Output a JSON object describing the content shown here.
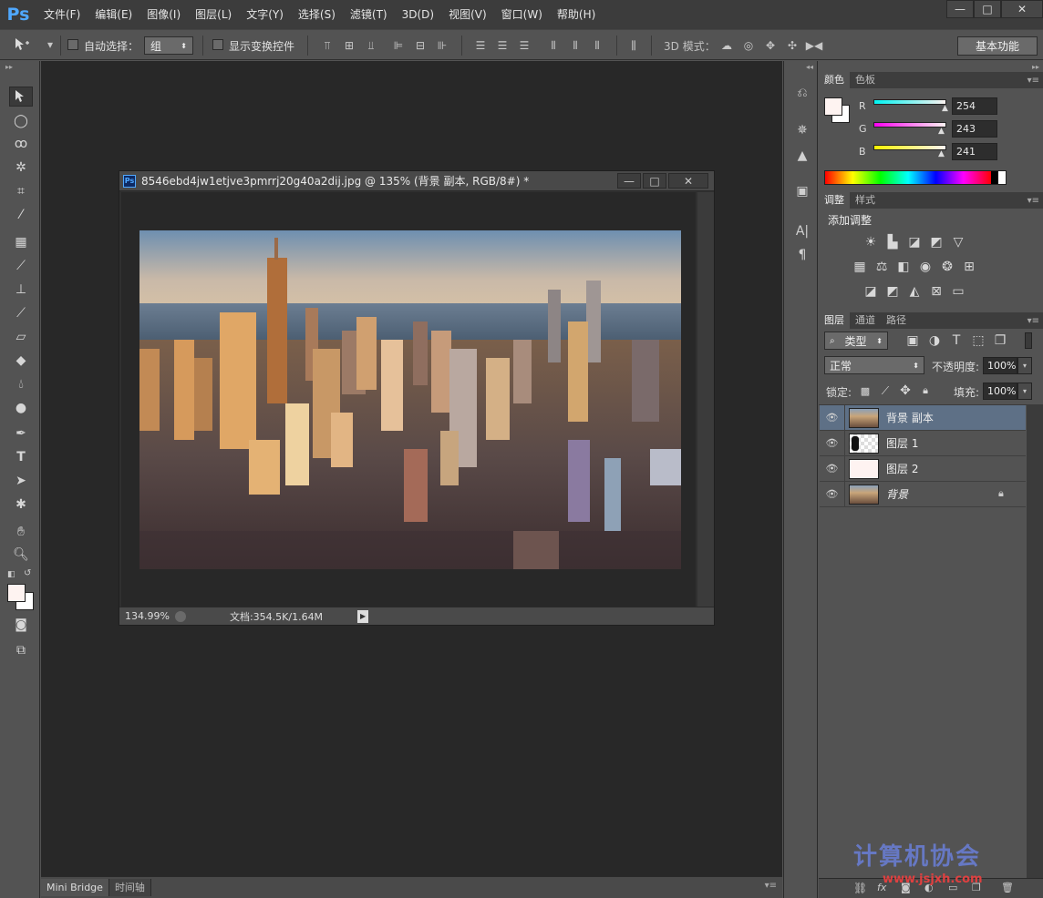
{
  "app": {
    "logo": "Ps",
    "window_controls": [
      "—",
      "□",
      "✕"
    ]
  },
  "menu": [
    "文件(F)",
    "编辑(E)",
    "图像(I)",
    "图层(L)",
    "文字(Y)",
    "选择(S)",
    "滤镜(T)",
    "3D(D)",
    "视图(V)",
    "窗口(W)",
    "帮助(H)"
  ],
  "options": {
    "auto_select_label": "自动选择：",
    "auto_select_value": "组",
    "show_transform_label": "显示变换控件",
    "mode_3d_label": "3D 模式：",
    "workspace": "基本功能"
  },
  "document": {
    "title": "8546ebd4jw1etjve3pmrrj20g40a2dij.jpg @ 135% (背景 副本, RGB/8#) *",
    "zoom": "134.99%",
    "doc_info": "文档:354.5K/1.64M"
  },
  "bottom_tabs": [
    "Mini Bridge",
    "时间轴"
  ],
  "color_panel": {
    "tabs": [
      "颜色",
      "色板"
    ],
    "channels": [
      {
        "label": "R",
        "value": "254",
        "level": 0.996
      },
      {
        "label": "G",
        "value": "243",
        "level": 0.953
      },
      {
        "label": "B",
        "value": "241",
        "level": 0.945
      }
    ],
    "foreground": "#fef3f1",
    "background": "#ffffff"
  },
  "adjust_panel": {
    "tabs": [
      "调整",
      "样式"
    ],
    "heading": "添加调整"
  },
  "layers_panel": {
    "tabs": [
      "图层",
      "通道",
      "路径"
    ],
    "filter_type": "类型",
    "blend_mode": "正常",
    "opacity_label": "不透明度:",
    "opacity": "100%",
    "lock_label": "锁定:",
    "fill_label": "填充:",
    "fill": "100%",
    "layers": [
      {
        "name": "背景 副本",
        "selected": true
      },
      {
        "name": "图层 1",
        "selected": false
      },
      {
        "name": "图层 2",
        "selected": false
      },
      {
        "name": "背景",
        "selected": false,
        "locked": true
      }
    ]
  },
  "watermark": {
    "text": "计算机协会",
    "url": "www.jsjxh.com"
  }
}
